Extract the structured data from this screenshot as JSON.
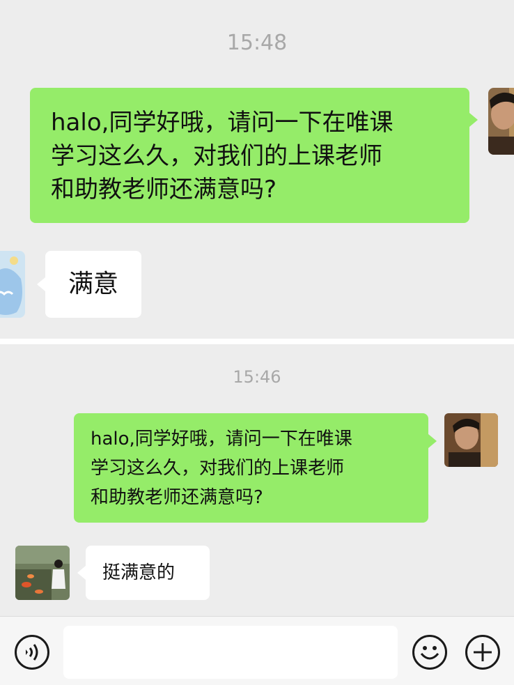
{
  "top_panel": {
    "timestamp": "15:48",
    "outgoing_lines": [
      "halo,同学好哦，请问一下在唯课",
      "学习这么久，对我们的上课老师",
      "和助教老师还满意吗?"
    ],
    "incoming_text": "满意"
  },
  "bottom_panel": {
    "timestamp": "15:46",
    "outgoing_lines": [
      "halo,同学好哦，请问一下在唯课",
      "学习这么久，对我们的上课老师",
      "和助教老师还满意吗?"
    ],
    "incoming_text": "挺满意的"
  },
  "input_bar": {
    "placeholder": "",
    "icons": [
      "voice-icon",
      "emoji-icon",
      "plus-icon"
    ]
  },
  "colors": {
    "outgoing_bubble": "#95ec69",
    "incoming_bubble": "#ffffff",
    "background": "#ededed"
  }
}
